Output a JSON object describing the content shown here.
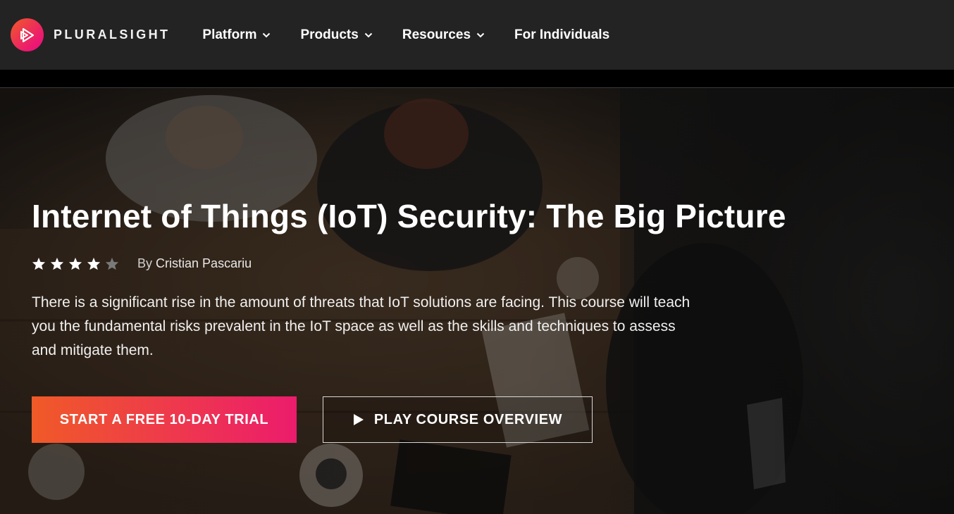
{
  "brand": {
    "name": "PLURALSIGHT",
    "accent_start": "#f05a28",
    "accent_end": "#ec1c6c",
    "logo_icon": "play-logo-icon"
  },
  "nav": {
    "items": [
      {
        "label": "Platform",
        "has_dropdown": true
      },
      {
        "label": "Products",
        "has_dropdown": true
      },
      {
        "label": "Resources",
        "has_dropdown": true
      },
      {
        "label": "For Individuals",
        "has_dropdown": false
      }
    ]
  },
  "course": {
    "title": "Internet of Things (IoT) Security: The Big Picture",
    "rating": {
      "value": 4,
      "max": 5
    },
    "author_prefix": "By",
    "author": "Cristian Pascariu",
    "description": "There is a significant rise in the amount of threats that IoT solutions are facing. This course will teach you the fundamental risks prevalent in the IoT space as well as the skills and techniques to assess and mitigate them."
  },
  "actions": {
    "trial_label": "START A FREE 10-DAY TRIAL",
    "overview_label": "PLAY COURSE OVERVIEW",
    "overview_icon": "play-icon"
  }
}
